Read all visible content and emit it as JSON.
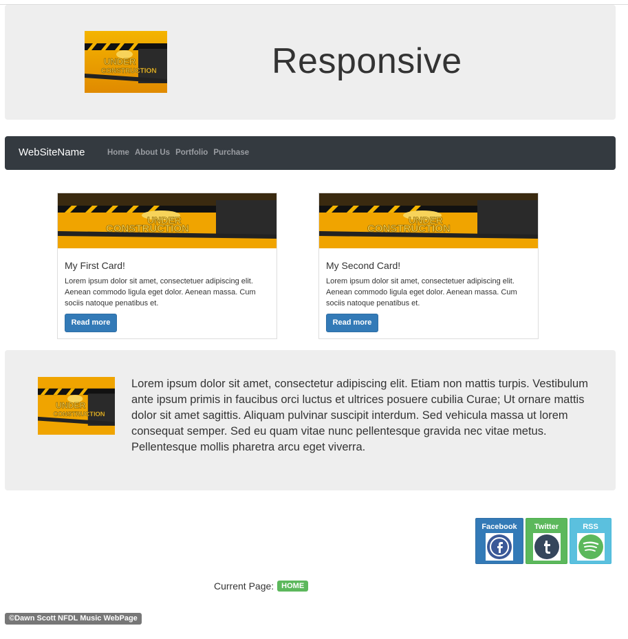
{
  "header": {
    "title": "Responsive",
    "logo_icon": "under-construction-image"
  },
  "navbar": {
    "brand": "WebSiteName",
    "items": [
      {
        "label": "Home"
      },
      {
        "label": "About Us"
      },
      {
        "label": "Portfolio"
      },
      {
        "label": "Purchase"
      }
    ]
  },
  "cards": [
    {
      "title": "My First Card!",
      "text": "Lorem ipsum dolor sit amet, consectetuer adipiscing elit. Aenean commodo ligula eget dolor. Aenean massa. Cum sociis natoque penatibus et.",
      "button": "Read more"
    },
    {
      "title": "My Second Card!",
      "text": "Lorem ipsum dolor sit amet, consectetuer adipiscing elit. Aenean commodo ligula eget dolor. Aenean massa. Cum sociis natoque penatibus et.",
      "button": "Read more"
    }
  ],
  "feature": {
    "text": "Lorem ipsum dolor sit amet, consectetur adipiscing elit. Etiam non mattis turpis. Vestibulum ante ipsum primis in faucibus orci luctus et ultrices posuere cubilia Curae; Ut ornare mattis dolor sit amet sagittis. Aliquam pulvinar suscipit interdum. Sed vehicula massa ut lorem consequat semper. Sed eu quam vitae nunc pellentesque gravida nec vitae metus. Pellentesque mollis pharetra arcu eget viverra."
  },
  "social": {
    "facebook": "Facebook",
    "twitter": "Twitter",
    "rss": "RSS"
  },
  "current_page": {
    "label": "Current Page:",
    "badge": "HOME"
  },
  "footer": {
    "text": "©Dawn Scott NFDL Music WebPage"
  },
  "colors": {
    "navbar_bg": "#343a40",
    "primary": "#337ab7",
    "success": "#5cb85c",
    "info": "#5bc0de",
    "jumbotron_bg": "#eeeeee"
  }
}
